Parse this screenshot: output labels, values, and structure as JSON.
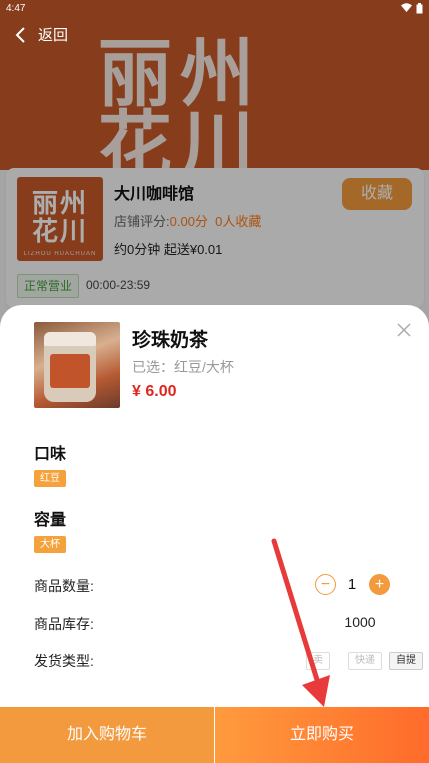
{
  "status_bar": {
    "time": "4:47"
  },
  "nav": {
    "back_label": "返回"
  },
  "banner": {
    "logo_text": "丽州\n花川"
  },
  "shop": {
    "logo_text": "丽州\n花川",
    "logo_sub": "LIZHOU HUACHUAN",
    "name": "大川咖啡馆",
    "rating_label": "店铺评分:",
    "rating_value": "0.00分",
    "collect_count": "0人收藏",
    "delivery": "约0分钟  起送¥0.01",
    "collect_button": "收藏",
    "status_badge": "正常营业",
    "hours": "00:00-23:59"
  },
  "sheet": {
    "product_name": "珍珠奶茶",
    "selected_text": "已选：红豆/大杯",
    "price": "¥ 6.00",
    "flavor_title": "口味",
    "flavor_option": "红豆",
    "size_title": "容量",
    "size_option": "大杯",
    "qty_label": "商品数量:",
    "qty_value": "1",
    "stock_label": "商品库存:",
    "stock_value": "1000",
    "ship_label": "发货类型:",
    "ship_options": [
      "卖",
      "快递",
      "自提"
    ]
  },
  "actions": {
    "add_to_cart": "加入购物车",
    "buy_now": "立即购买"
  },
  "colors": {
    "brand_orange": "#f29a3d",
    "price_red": "#e0271f",
    "banner": "#c75a2a"
  }
}
